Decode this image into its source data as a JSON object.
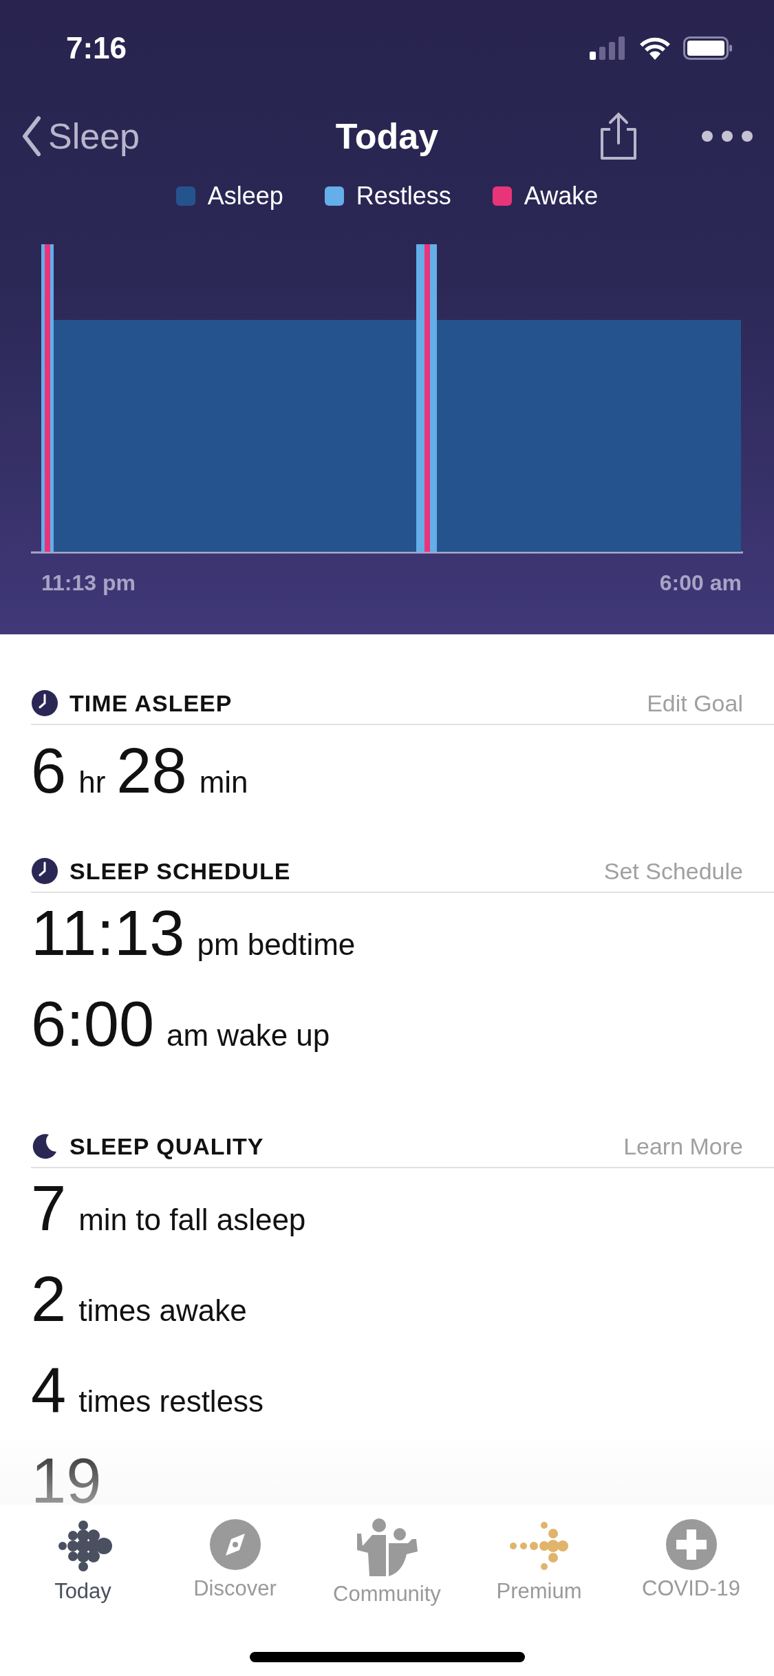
{
  "status_bar": {
    "time": "7:16"
  },
  "nav": {
    "back": "Sleep",
    "title": "Today"
  },
  "legend": [
    {
      "label": "Asleep",
      "color": "#25538d"
    },
    {
      "label": "Restless",
      "color": "#64aee9"
    },
    {
      "label": "Awake",
      "color": "#e8357a"
    }
  ],
  "chart": {
    "start_label": "11:13 pm",
    "end_label": "6:00 am"
  },
  "sections": [
    {
      "kind": "clock",
      "title": "TIME ASLEEP",
      "action": "Edit Goal",
      "inline": true,
      "rows": [
        {
          "value": "6",
          "unit": "hr"
        },
        {
          "value": "28",
          "unit": "min"
        }
      ]
    },
    {
      "kind": "clock",
      "title": "SLEEP SCHEDULE",
      "action": "Set Schedule",
      "inline": false,
      "rows": [
        {
          "value": "11:13",
          "unit": "pm bedtime"
        },
        {
          "value": "6:00",
          "unit": "am wake up"
        }
      ]
    },
    {
      "kind": "moon",
      "title": "SLEEP QUALITY",
      "action": "Learn More",
      "inline": false,
      "rows": [
        {
          "value": "7",
          "unit": "min to fall asleep"
        },
        {
          "value": "2",
          "unit": "times awake"
        },
        {
          "value": "4",
          "unit": "times restless"
        },
        {
          "value": "19"
        }
      ]
    }
  ],
  "tabs": [
    {
      "kind": "dots",
      "label": "Today",
      "selected": true
    },
    {
      "kind": "compass",
      "label": "Discover",
      "selected": false
    },
    {
      "kind": "people",
      "label": "Community",
      "selected": false
    },
    {
      "kind": "premium",
      "label": "Premium",
      "selected": false
    },
    {
      "kind": "cross",
      "label": "COVID-19",
      "selected": false
    }
  ]
}
